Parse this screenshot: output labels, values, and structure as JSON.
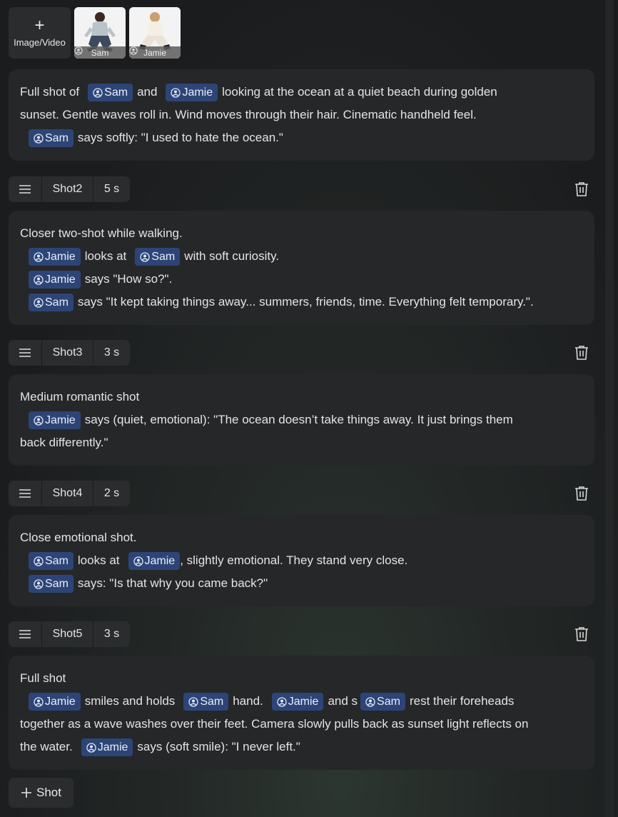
{
  "upload": {
    "icon": "plus-icon",
    "label": "Image/Video"
  },
  "characters": [
    {
      "name": "Sam",
      "icon": "character-icon"
    },
    {
      "name": "Jamie",
      "icon": "character-icon"
    }
  ],
  "shot1": {
    "t1": "Full shot of",
    "c1": "Sam",
    "t2": "and",
    "c2": "Jamie",
    "t3": "looking at the ocean at a quiet beach during golden",
    "t4": "sunset. Gentle waves roll in. Wind moves through their hair. Cinematic handheld feel.",
    "c3": "Sam",
    "t5": "says softly: \"I used to hate the ocean.\""
  },
  "shot2": {
    "name": "Shot2",
    "duration": "5 s",
    "t1": "Closer two-shot while walking.",
    "c1": "Jamie",
    "t2": "looks at",
    "c2": "Sam",
    "t3": "with soft curiosity.",
    "c3": "Jamie",
    "t4": "says \"How so?\".",
    "c4": "Sam",
    "t5": "says \"It kept taking things away... summers, friends, time. Everything felt temporary.\"."
  },
  "shot3": {
    "name": "Shot3",
    "duration": "3 s",
    "t1": "Medium romantic shot",
    "c1": "Jamie",
    "t2": "says (quiet, emotional): \"The ocean doesn’t take things away. It just brings them",
    "t3": "back differently.\""
  },
  "shot4": {
    "name": "Shot4",
    "duration": "2 s",
    "t1": "Close emotional shot.",
    "c1": "Sam",
    "t2": "looks at",
    "c2": "Jamie",
    "t3": ", slightly emotional. They stand very close.",
    "c3": "Sam",
    "t4": "says: \"Is that why you came back?\""
  },
  "shot5": {
    "name": "Shot5",
    "duration": "3 s",
    "t1": "Full shot",
    "c1": "Jamie",
    "t2": "smiles and holds",
    "c2": "Sam",
    "t3": "hand.",
    "c3": "Jamie",
    "t4": "and s",
    "c4": "Sam",
    "t5": "rest their foreheads",
    "t6": "together as a wave washes over their feet. Camera slowly pulls back as sunset light reflects on",
    "t7": "the water.",
    "c5": "Jamie",
    "t8": "says (soft smile): \"I never left.\""
  },
  "add_shot": {
    "icon": "plus-icon",
    "label": "Shot"
  },
  "colors": {
    "chip_bg": "#2d4576",
    "card_bg": "#262729",
    "page_bg": "#1b1c1e"
  }
}
